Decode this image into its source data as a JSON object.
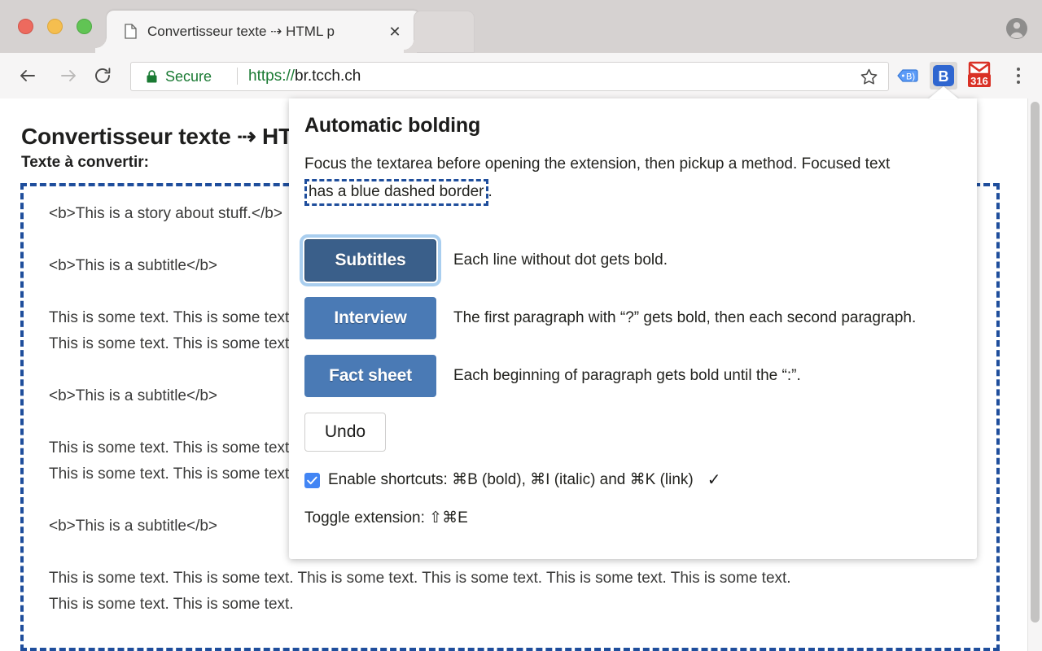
{
  "window": {
    "traffic_lights": [
      "close",
      "minimize",
      "zoom"
    ],
    "colors": {
      "close": "#ed6a5e",
      "minimize": "#f5be4f",
      "zoom": "#61c454",
      "accent_blue": "#4a7ab5",
      "accent_blue_focused": "#3a5f8a",
      "focus_ring": "#a9ceef",
      "dashed_border": "#1f4e9c",
      "secure_green": "#1a7a33",
      "checkbox_blue": "#4285f4",
      "gmail_red": "#d93025"
    }
  },
  "tabs": [
    {
      "title": "Convertisseur texte ⇢ HTML p",
      "favicon": "page-icon",
      "close_label": "✕"
    }
  ],
  "toolbar": {
    "back_icon": "arrow-left-icon",
    "forward_icon": "arrow-right-icon",
    "reload_icon": "reload-icon",
    "security_label": "Secure",
    "lock_icon": "lock-icon",
    "url_scheme": "https://",
    "url_host": "br.tcch.ch",
    "star_icon": "star-icon",
    "extensions": [
      {
        "name": "tag-extension-icon",
        "label": ""
      },
      {
        "name": "bold-extension-icon",
        "label": "B",
        "active": true
      },
      {
        "name": "gmail-icon",
        "badge": "316"
      }
    ],
    "menu_icon": "three-dots-icon"
  },
  "page": {
    "heading": "Convertisseur texte ⇢ HTML p",
    "label": "Texte à convertir:",
    "textarea": {
      "focused": true,
      "paragraphs": [
        "<b>This is a story about stuff.</b>",
        "<b>This is a subtitle</b>",
        "This is some text. This is some text. This is some text.\nThis is some text. This is some text. This is some text.",
        "<b>This is a subtitle</b>",
        "This is some text. This is some text. This is some text.\nThis is some text. This is some text. This is some text.",
        "<b>This is a subtitle</b>",
        "This is some text. This is some text. This is some text. This is some text. This is some text. This is some text.\nThis is some text. This is some text."
      ]
    }
  },
  "popup": {
    "title": "Automatic bolding",
    "description_before": "Focus the textarea before opening the extension, then pickup a method. Focused text ",
    "description_highlight": "has a blue dashed border",
    "description_after": ".",
    "methods": [
      {
        "label": "Subtitles",
        "description": "Each line without dot gets bold.",
        "focused": true
      },
      {
        "label": "Interview",
        "description": "The first paragraph with “?” gets bold, then each second paragraph.",
        "focused": false
      },
      {
        "label": "Fact sheet",
        "description": "Each beginning of paragraph gets bold until the “:”.",
        "focused": false
      }
    ],
    "undo_label": "Undo",
    "shortcuts": {
      "checked": true,
      "label": "Enable shortcuts: ⌘B (bold), ⌘I (italic) and ⌘K (link)",
      "confirm_mark": "✓"
    },
    "toggle_label": "Toggle extension: ⇧⌘E"
  }
}
